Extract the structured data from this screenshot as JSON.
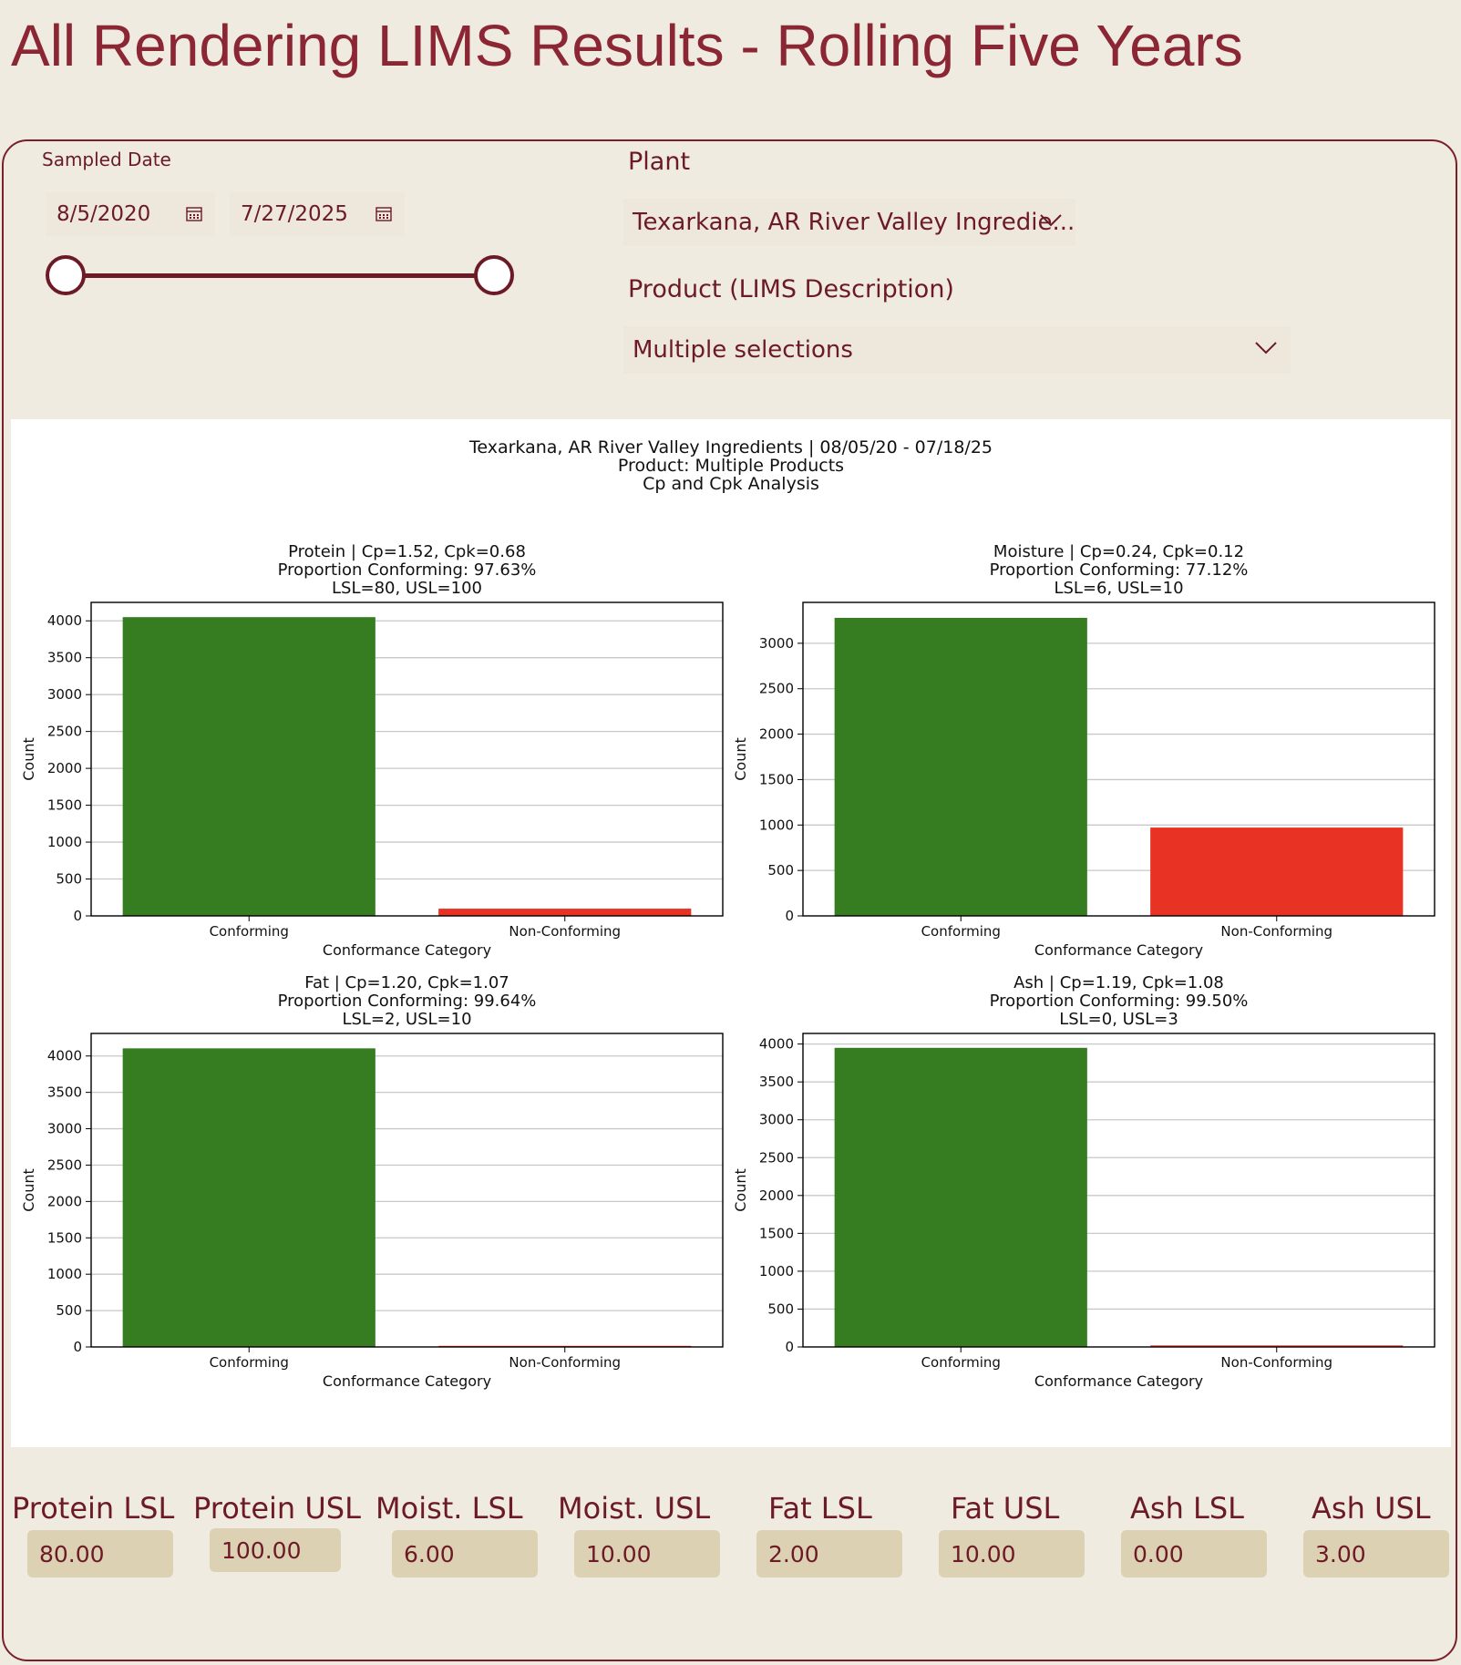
{
  "page": {
    "title": "All Rendering LIMS Results - Rolling Five Years"
  },
  "filters": {
    "sampled_date_label": "Sampled Date",
    "start_date": "8/5/2020",
    "end_date": "7/27/2025",
    "range_fraction": [
      0,
      1
    ],
    "plant_label": "Plant",
    "plant_value": "Texarkana, AR River Valley Ingredie...",
    "product_label": "Product (LIMS Description)",
    "product_value": "Multiple selections"
  },
  "figure": {
    "title_lines": [
      "Texarkana, AR River Valley Ingredients | 08/05/20 - 07/18/25",
      "Product: Multiple Products",
      "Cp and Cpk Analysis"
    ]
  },
  "colors": {
    "conforming": "#367c21",
    "non_conforming": "#e83223",
    "brand": "#7a1f2b"
  },
  "chart_data": [
    {
      "type": "bar",
      "title_lines": [
        "Protein | Cp=1.52, Cpk=0.68",
        "Proportion Conforming: 97.63%",
        "LSL=80, USL=100"
      ],
      "categories": [
        "Conforming",
        "Non-Conforming"
      ],
      "values": [
        4050,
        98
      ],
      "xlabel": "Conformance Category",
      "ylabel": "Count",
      "ylim": [
        0,
        4250
      ],
      "yticks": [
        0,
        500,
        1000,
        1500,
        2000,
        2500,
        3000,
        3500,
        4000
      ],
      "grid": true
    },
    {
      "type": "bar",
      "title_lines": [
        "Moisture | Cp=0.24, Cpk=0.12",
        "Proportion Conforming: 77.12%",
        "LSL=6, USL=10"
      ],
      "categories": [
        "Conforming",
        "Non-Conforming"
      ],
      "values": [
        3280,
        972
      ],
      "xlabel": "Conformance Category",
      "ylabel": "Count",
      "ylim": [
        0,
        3450
      ],
      "yticks": [
        0,
        500,
        1000,
        1500,
        2000,
        2500,
        3000
      ],
      "grid": true
    },
    {
      "type": "bar",
      "title_lines": [
        "Fat | Cp=1.20, Cpk=1.07",
        "Proportion Conforming: 99.64%",
        "LSL=2, USL=10"
      ],
      "categories": [
        "Conforming",
        "Non-Conforming"
      ],
      "values": [
        4105,
        15
      ],
      "xlabel": "Conformance Category",
      "ylabel": "Count",
      "ylim": [
        0,
        4310
      ],
      "yticks": [
        0,
        500,
        1000,
        1500,
        2000,
        2500,
        3000,
        3500,
        4000
      ],
      "grid": true
    },
    {
      "type": "bar",
      "title_lines": [
        "Ash | Cp=1.19, Cpk=1.08",
        "Proportion Conforming: 99.50%",
        "LSL=0, USL=3"
      ],
      "categories": [
        "Conforming",
        "Non-Conforming"
      ],
      "values": [
        3950,
        20
      ],
      "xlabel": "Conformance Category",
      "ylabel": "Count",
      "ylim": [
        0,
        4140
      ],
      "yticks": [
        0,
        500,
        1000,
        1500,
        2000,
        2500,
        3000,
        3500,
        4000
      ],
      "grid": true
    }
  ],
  "limits": [
    {
      "label": "Protein LSL",
      "value": "80.00"
    },
    {
      "label": "Protein USL",
      "value": "100.00"
    },
    {
      "label": "Moist. LSL",
      "value": "6.00"
    },
    {
      "label": "Moist. USL",
      "value": "10.00"
    },
    {
      "label": "Fat LSL",
      "value": "2.00"
    },
    {
      "label": "Fat USL",
      "value": "10.00"
    },
    {
      "label": "Ash LSL",
      "value": "0.00"
    },
    {
      "label": "Ash USL",
      "value": "3.00"
    }
  ]
}
